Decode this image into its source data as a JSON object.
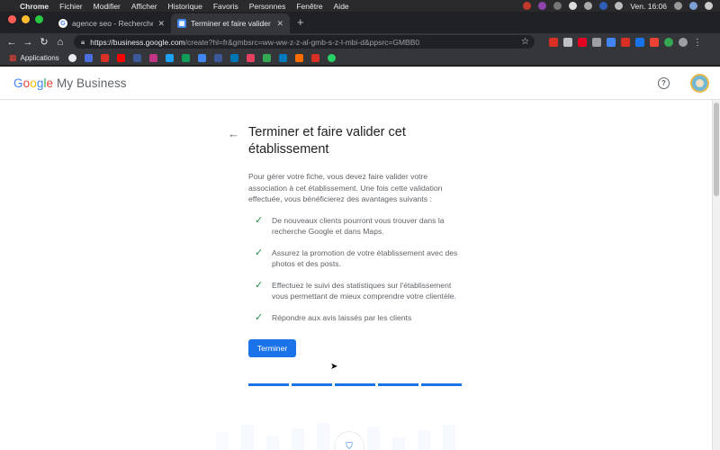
{
  "os_menubar": {
    "apple": "",
    "app_name": "Chrome",
    "menus": [
      "Fichier",
      "Modifier",
      "Afficher",
      "Historique",
      "Favoris",
      "Personnes",
      "Fenêtre",
      "Aide"
    ],
    "clock": "Ven. 16:06"
  },
  "browser": {
    "tabs": [
      {
        "title": "agence seo - Recherche Google",
        "active": false
      },
      {
        "title": "Terminer et faire valider cet ét",
        "active": true
      }
    ],
    "new_tab": "+",
    "url_host": "https://business.google.com",
    "url_rest": "/create?hl=fr&gmbsrc=ww-ww-z-z-al-gmb-s-z-l-mbi-d&ppsrc=GMBB0",
    "bookmarks_label": "Applications"
  },
  "header": {
    "logo_google": [
      "G",
      "o",
      "o",
      "g",
      "l",
      "e"
    ],
    "logo_product": "My Business",
    "help": "?"
  },
  "main": {
    "back": "←",
    "title": "Terminer et faire valider cet établissement",
    "intro": "Pour gérer votre fiche, vous devez faire valider votre association à cet établissement. Une fois cette validation effectuée, vous bénéficierez des avantages suivants :",
    "check_glyph": "✓",
    "benefits": [
      "De nouveaux clients pourront vous trouver dans la recherche Google et dans Maps.",
      "Assurez la promotion de votre établissement avec des photos et des posts.",
      "Effectuez le suivi des statistiques sur l'établissement vous permettant de mieux comprendre votre clientèle.",
      "Répondre aux avis laissés par les clients"
    ],
    "button_label": "Terminer"
  },
  "colors": {
    "accent": "#1a73e8",
    "check": "#1e8e3e"
  }
}
